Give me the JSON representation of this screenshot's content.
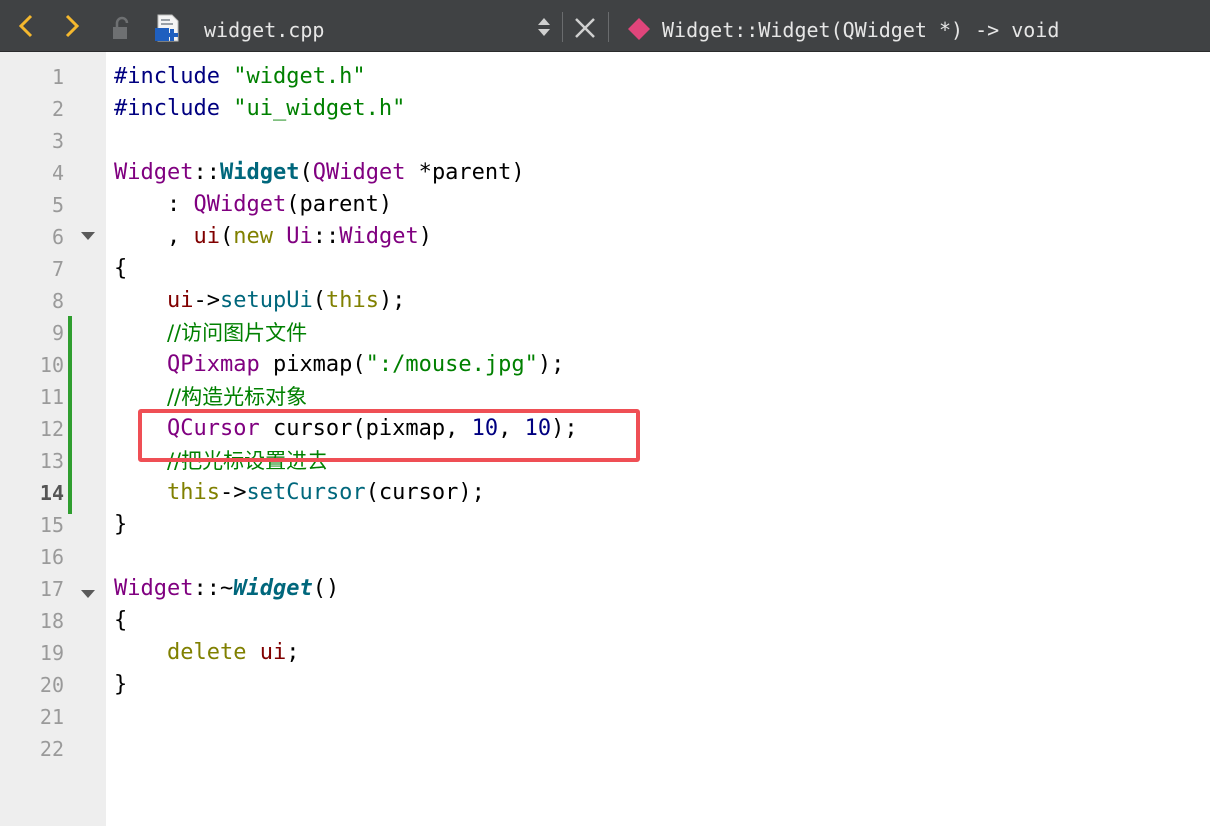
{
  "toolbar": {
    "back_icon": "chevron-left-icon",
    "forward_icon": "chevron-right-icon",
    "lock_icon": "unlock-icon",
    "file_icon": "cpp-file-icon",
    "file_name": "widget.cpp",
    "symbol_icon": "method-icon",
    "symbol": "Widget::Widget(QWidget *) -> void",
    "accent_color": "#f5b82e",
    "symbol_color": "#e0457b"
  },
  "editor": {
    "current_line": 14,
    "line_numbers": [
      "1",
      "2",
      "3",
      "4",
      "5",
      "6",
      "7",
      "8",
      "9",
      "10",
      "11",
      "12",
      "13",
      "14",
      "15",
      "16",
      "17",
      "18",
      "19",
      "20",
      "21",
      "22"
    ],
    "lines": [
      [
        [
          "t-pre",
          "#include "
        ],
        [
          "t-str",
          "\"widget.h\""
        ]
      ],
      [
        [
          "t-pre",
          "#include "
        ],
        [
          "t-str",
          "\"ui_widget.h\""
        ]
      ],
      [],
      [
        [
          "t-type",
          "Widget"
        ],
        [
          "t-op",
          "::"
        ],
        [
          "t-fnb",
          "Widget"
        ],
        [
          "t-op",
          "("
        ],
        [
          "t-type",
          "QWidget"
        ],
        [
          "t-op",
          " *"
        ],
        [
          "t-op",
          "parent"
        ],
        [
          "t-op",
          ")"
        ]
      ],
      [
        [
          "t-op",
          "    : "
        ],
        [
          "t-type",
          "QWidget"
        ],
        [
          "t-op",
          "(parent)"
        ]
      ],
      [
        [
          "t-op",
          "    , "
        ],
        [
          "t-mem",
          "ui"
        ],
        [
          "t-op",
          "("
        ],
        [
          "t-kw",
          "new "
        ],
        [
          "t-type",
          "Ui"
        ],
        [
          "t-op",
          "::"
        ],
        [
          "t-type",
          "Widget"
        ],
        [
          "t-op",
          ")"
        ]
      ],
      [
        [
          "t-op",
          "{"
        ]
      ],
      [
        [
          "t-op",
          "    "
        ],
        [
          "t-mem",
          "ui"
        ],
        [
          "t-op",
          "->"
        ],
        [
          "t-fn",
          "setupUi"
        ],
        [
          "t-op",
          "("
        ],
        [
          "t-kw",
          "this"
        ],
        [
          "t-op",
          ");"
        ]
      ],
      [
        [
          "t-op",
          "    "
        ],
        [
          "t-cmt",
          "//访问图片文件"
        ]
      ],
      [
        [
          "t-op",
          "    "
        ],
        [
          "t-type",
          "QPixmap"
        ],
        [
          "t-op",
          " pixmap("
        ],
        [
          "t-str",
          "\":/mouse.jpg\""
        ],
        [
          "t-op",
          ");"
        ]
      ],
      [
        [
          "t-op",
          "    "
        ],
        [
          "t-cmt",
          "//构造光标对象"
        ]
      ],
      [
        [
          "t-op",
          "    "
        ],
        [
          "t-type",
          "QCursor"
        ],
        [
          "t-op",
          " cursor(pixmap, "
        ],
        [
          "t-num",
          "10"
        ],
        [
          "t-op",
          ", "
        ],
        [
          "t-num",
          "10"
        ],
        [
          "t-op",
          ");"
        ]
      ],
      [
        [
          "t-op",
          "    "
        ],
        [
          "t-cmt",
          "//把光标设置进去"
        ]
      ],
      [
        [
          "t-op",
          "    "
        ],
        [
          "t-kw",
          "this"
        ],
        [
          "t-op",
          "->"
        ],
        [
          "t-fn",
          "setCursor"
        ],
        [
          "t-op",
          "(cursor);"
        ]
      ],
      [
        [
          "t-op",
          "}"
        ]
      ],
      [],
      [
        [
          "t-type",
          "Widget"
        ],
        [
          "t-op",
          "::~"
        ],
        [
          "t-fnbi",
          "Widget"
        ],
        [
          "t-op",
          "()"
        ]
      ],
      [
        [
          "t-op",
          "{"
        ]
      ],
      [
        [
          "t-op",
          "    "
        ],
        [
          "t-kw",
          "delete "
        ],
        [
          "t-mem",
          "ui"
        ],
        [
          "t-op",
          ";"
        ]
      ],
      [
        [
          "t-op",
          "}"
        ]
      ],
      [],
      []
    ]
  }
}
